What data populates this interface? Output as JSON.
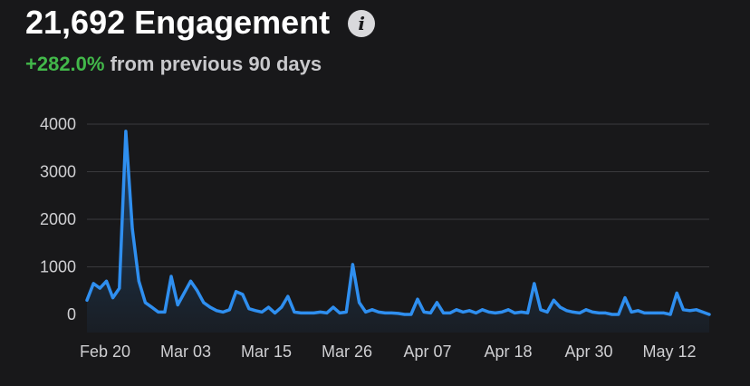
{
  "header": {
    "value": "21,692",
    "metric": "Engagement",
    "info_icon": "info-icon",
    "delta": "+282.0%",
    "delta_color": "#42b84a",
    "comparison": "from previous 90 days"
  },
  "chart_data": {
    "type": "area",
    "title": "",
    "xlabel": "",
    "ylabel": "",
    "ylim": [
      0,
      4000
    ],
    "y_ticks": [
      0,
      1000,
      2000,
      3000,
      4000
    ],
    "x_tick_labels": [
      "Feb 20",
      "Mar 03",
      "Mar 15",
      "Mar 26",
      "Apr 07",
      "Apr 18",
      "Apr 30",
      "May 12"
    ],
    "grid": true,
    "line_color": "#2f8ff0",
    "series": [
      {
        "values": [
          300,
          650,
          550,
          700,
          350,
          550,
          3850,
          1800,
          700,
          250,
          150,
          50,
          50,
          800,
          200,
          450,
          700,
          500,
          250,
          150,
          80,
          50,
          100,
          480,
          420,
          120,
          80,
          50,
          150,
          30,
          150,
          380,
          50,
          30,
          30,
          30,
          50,
          30,
          150,
          30,
          50,
          1050,
          250,
          50,
          100,
          50,
          30,
          30,
          20,
          0,
          0,
          320,
          50,
          30,
          250,
          30,
          30,
          100,
          50,
          80,
          30,
          100,
          50,
          30,
          50,
          100,
          30,
          50,
          30,
          650,
          100,
          50,
          300,
          150,
          80,
          50,
          30,
          100,
          50,
          30,
          30,
          0,
          0,
          350,
          50,
          80,
          30,
          30,
          30,
          30,
          0,
          450,
          100,
          80,
          100,
          50,
          0
        ]
      }
    ]
  }
}
